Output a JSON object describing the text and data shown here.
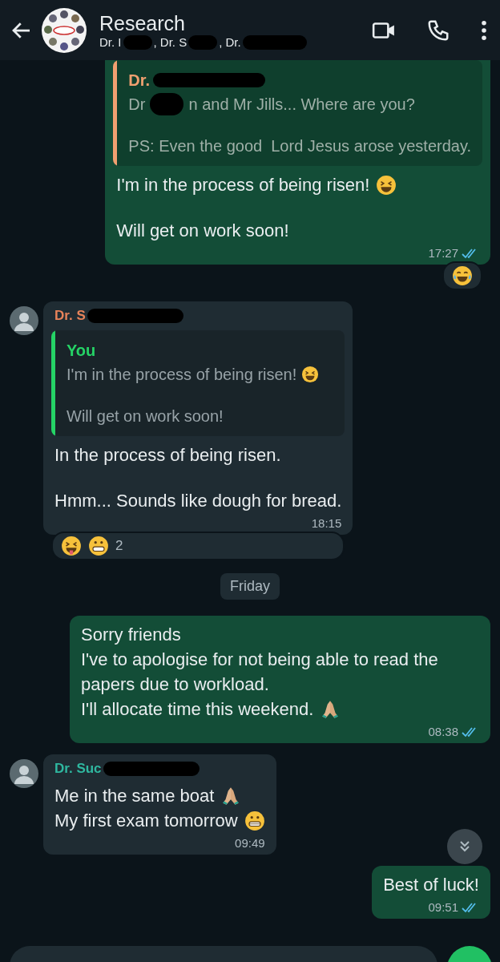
{
  "header": {
    "title": "Research",
    "subtitle_parts": [
      "Dr. I",
      ", Dr. S",
      ", Dr."
    ]
  },
  "messages": [
    {
      "kind": "outgoing",
      "quote": {
        "author": {
          "name": "Dr.",
          "color": "#f0a070"
        },
        "paragraphs": [
          [
            [
              "Dr",
              "n and Mr Jills... Where are you?"
            ]
          ],
          [
            [
              "PS: Even the good  Lord Jesus arose yesterday."
            ]
          ]
        ]
      },
      "paragraphs": [
        [
          {
            "text": "I'm in the process of being risen!",
            "emoji": {
              "kind": "grin-squint"
            }
          }
        ],
        [
          {
            "text": "Will get on work soon!"
          }
        ]
      ],
      "time": "17:27",
      "read": true,
      "reactions": [
        {
          "kind": "tears-joy"
        }
      ]
    },
    {
      "kind": "incoming",
      "author": {
        "name": "Dr. S",
        "color": "#e8835a"
      },
      "quote": {
        "author": {
          "name": "You",
          "color": "#25d366"
        },
        "paragraphs": [
          [
            [
              "I'm in the process of being risen!"
            ]
          ],
          [
            [
              "Will get on work soon!"
            ]
          ]
        ]
      },
      "paragraphs": [
        [
          {
            "text": "In the process of being risen."
          }
        ],
        [
          {
            "text": "Hmm... Sounds like dough for bread."
          }
        ]
      ],
      "time": "18:15",
      "reactions": [
        {
          "kind": "tongue-squint"
        },
        {
          "kind": "grimace"
        }
      ],
      "reaction_count": "2"
    },
    {
      "kind": "date",
      "text": "Friday"
    },
    {
      "kind": "outgoing",
      "paragraphs": [
        [
          {
            "text": "Sorry friends"
          },
          {
            "text": "I've to apologise for not being able to read the papers due to workload."
          },
          {
            "text": "I'll allocate time this weekend.",
            "emoji": {
              "kind": "pray"
            }
          }
        ]
      ],
      "time": "08:38",
      "read": true
    },
    {
      "kind": "incoming",
      "author": {
        "name": "Dr. Suc",
        "color": "#2fb8a0"
      },
      "paragraphs": [
        [
          {
            "text": "Me in the same boat",
            "emoji": {
              "kind": "pray"
            }
          },
          {
            "text": "My first exam tomorrow",
            "emoji": {
              "kind": "grimace"
            }
          }
        ]
      ],
      "time": "09:49"
    },
    {
      "kind": "outgoing",
      "paragraphs": [
        [
          {
            "text": "Best of luck!"
          }
        ]
      ],
      "time": "09:51",
      "read": true
    }
  ]
}
